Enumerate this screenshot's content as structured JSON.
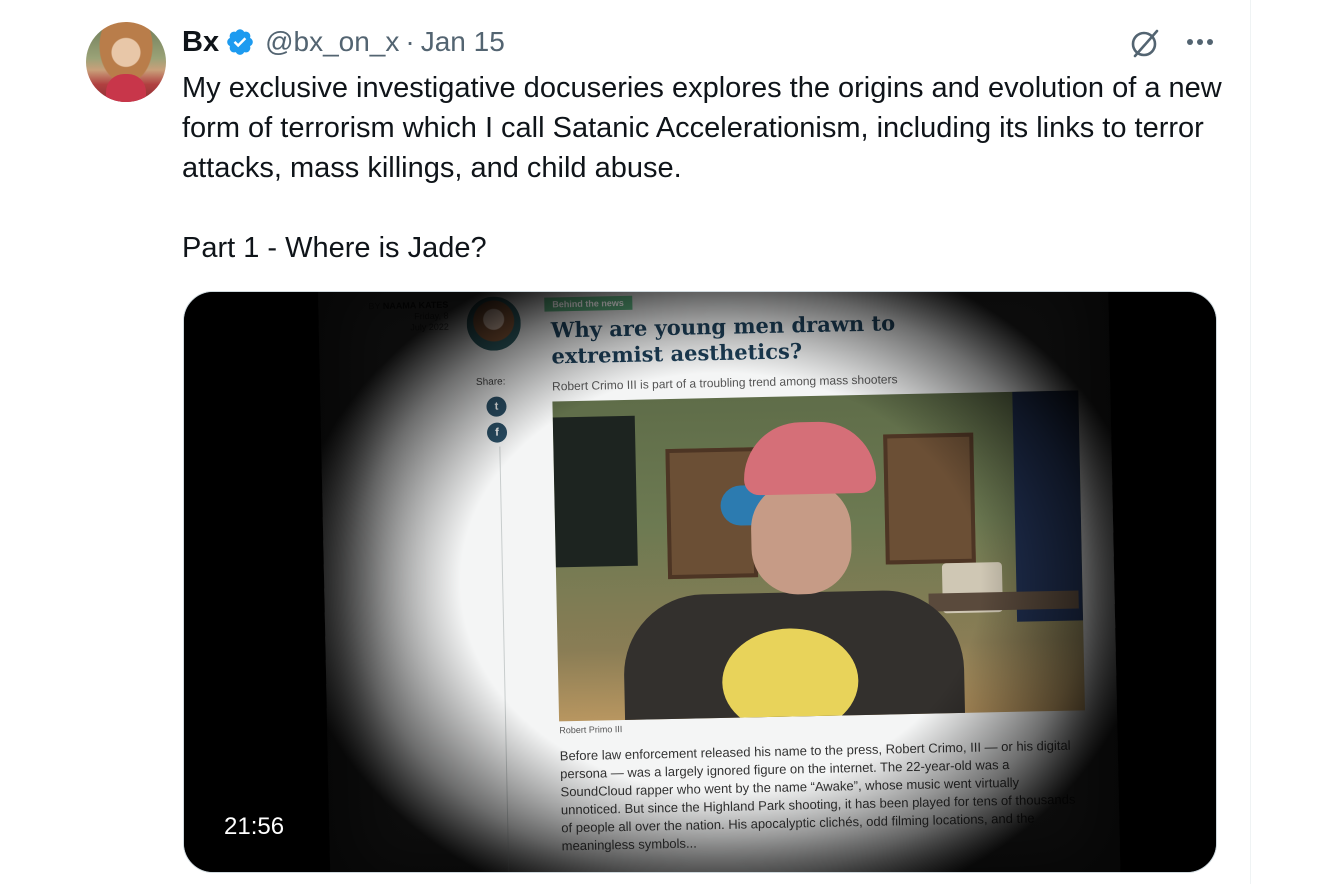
{
  "tweet": {
    "display_name": "Bx",
    "handle": "@bx_on_x",
    "separator": "·",
    "date": "Jan 15",
    "paragraphs": [
      "My exclusive investigative docuseries explores the origins and evolution of a new form of terrorism which I call Satanic Accelerationism, including its links to terror attacks, mass killings, and child abuse.",
      "Part 1 - Where is Jade?"
    ],
    "icons": {
      "verified": "verified-badge-icon",
      "grok": "grok-icon",
      "more": "more-options-icon"
    },
    "colors": {
      "text": "#0f1419",
      "secondary": "#536471",
      "verified": "#1d9bf0"
    }
  },
  "video": {
    "duration": "21:56",
    "article": {
      "byline_prefix": "BY",
      "author": "NAAMA KATES",
      "day": "Friday, 8",
      "month_year": "July 2022",
      "share_label": "Share:",
      "tag": "Behind the news",
      "headline": "Why are young men drawn to extremist aesthetics?",
      "subhead": "Robert Crimo III is part of a troubling trend among mass shooters",
      "photo_caption": "Robert Primo III",
      "body": "Before law enforcement released his name to the press, Robert Crimo, III — or his digital persona — was a largely ignored figure on the internet. The 22-year-old was a SoundCloud rapper who went by the name “Awake”, whose music went virtually unnoticed. But since the Highland Park shooting, it has been played for tens of thousands of people all over the nation. His apocalyptic clichés, odd filming locations, and the meaningless symbols..."
    }
  }
}
